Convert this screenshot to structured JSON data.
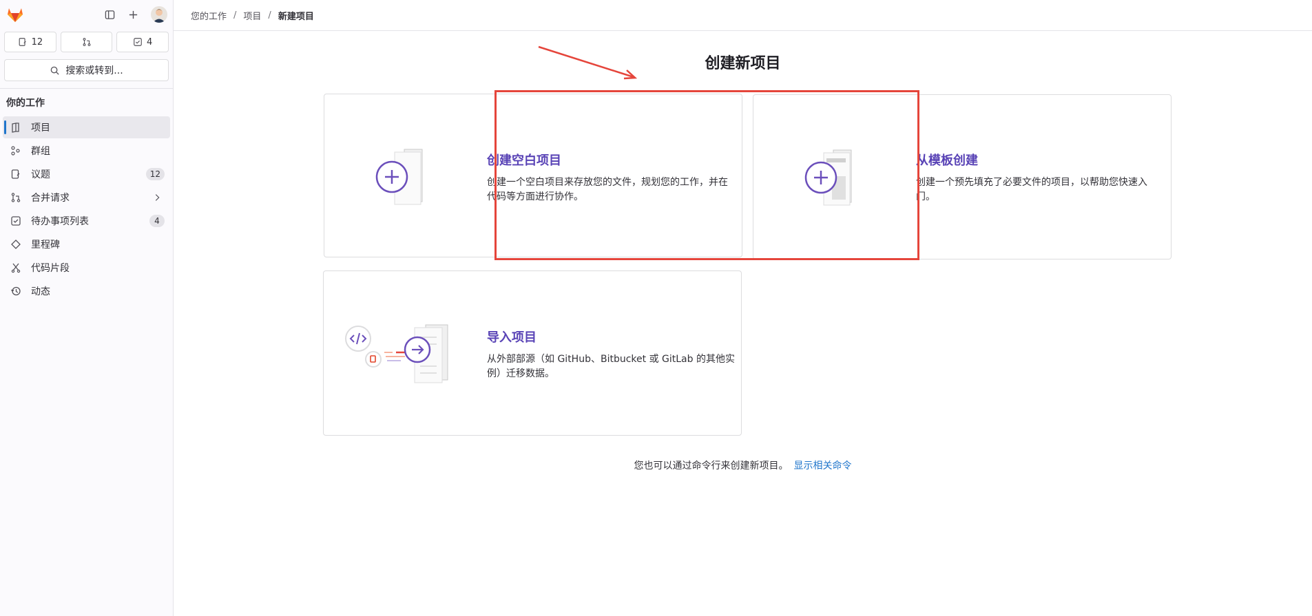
{
  "sidebar": {
    "counters": [
      {
        "icon": "issues-icon",
        "label": "12"
      },
      {
        "icon": "merge-request-icon",
        "label": ""
      },
      {
        "icon": "todo-icon",
        "label": "4"
      }
    ],
    "search_label": "搜索或转到...",
    "section_title": "你的工作",
    "items": [
      {
        "label": "项目",
        "icon": "project-icon",
        "active": true
      },
      {
        "label": "群组",
        "icon": "group-icon"
      },
      {
        "label": "议题",
        "icon": "issues-icon",
        "badge": "12"
      },
      {
        "label": "合并请求",
        "icon": "merge-request-icon",
        "chevron": true
      },
      {
        "label": "待办事项列表",
        "icon": "todo-icon",
        "badge": "4"
      },
      {
        "label": "里程碑",
        "icon": "milestone-icon"
      },
      {
        "label": "代码片段",
        "icon": "snippet-icon"
      },
      {
        "label": "动态",
        "icon": "history-icon"
      }
    ]
  },
  "breadcrumb": [
    "您的工作",
    "项目",
    "新建项目"
  ],
  "page_title": "创建新项目",
  "cards": [
    {
      "title": "创建空白项目",
      "desc": "创建一个空白项目来存放您的文件，规划您的工作，并在代码等方面进行协作。"
    },
    {
      "title": "从模板创建",
      "desc": "创建一个预先填充了必要文件的项目，以帮助您快速入门。"
    },
    {
      "title": "导入项目",
      "desc": "从外部部源（如 GitHub、Bitbucket 或 GitLab 的其他实例）迁移数据。"
    }
  ],
  "cli_hint": {
    "text": "您也可以通过命令行来创建新项目。",
    "link": "显示相关命令"
  },
  "colors": {
    "accent": "#5943b6",
    "link": "#1f75cb",
    "highlight": "#e5453b"
  }
}
